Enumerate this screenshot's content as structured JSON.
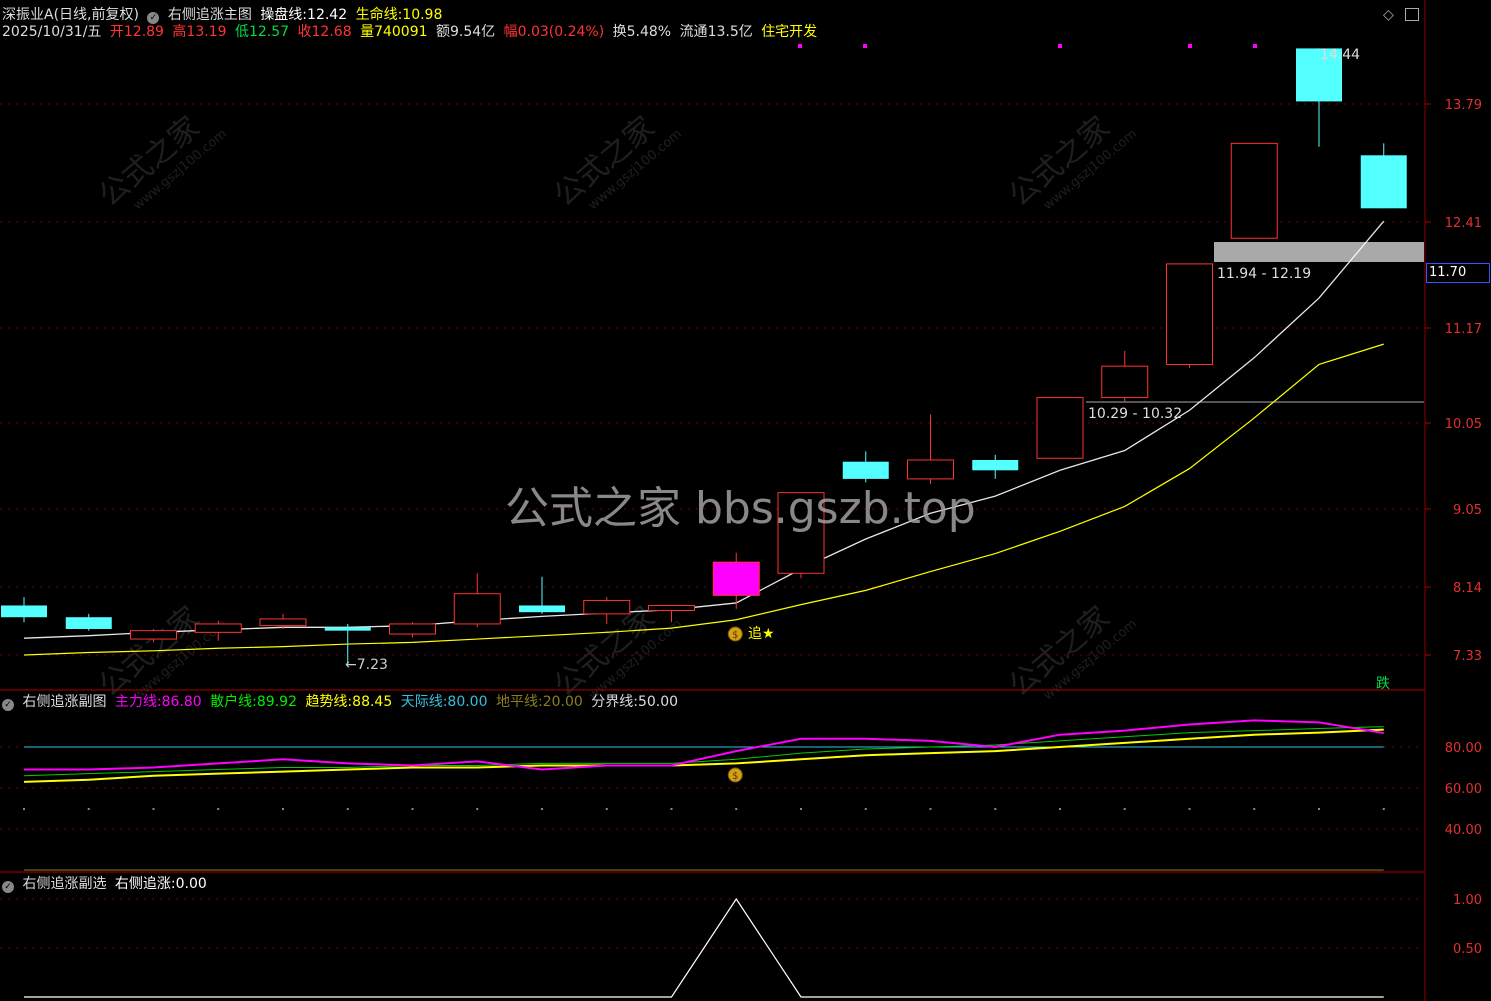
{
  "header": {
    "stock_name": "深振业A",
    "period": "(日线,前复权)",
    "indicator_name": "右侧追涨主图",
    "caopan_label": "操盘线:",
    "caopan_value": "12.42",
    "life_label": "生命线:",
    "life_value": "10.98",
    "date": "2025/10/31/五",
    "open_label": "开",
    "open": "12.89",
    "high_label": "高",
    "high": "13.19",
    "low_label": "低",
    "low": "12.57",
    "close_label": "收",
    "close": "12.68",
    "vol_label": "量",
    "vol": "740091",
    "amount_label": "额",
    "amount": "9.54亿",
    "change_label": "幅",
    "change": "0.03(0.24%)",
    "turnover_label": "换",
    "turnover": "5.48%",
    "float_label": "流通",
    "float": "13.5亿",
    "sector": "住宅开发"
  },
  "sub1": {
    "title": "右侧追涨副图",
    "zhuli_label": "主力线:",
    "zhuli_value": "86.80",
    "sanhu_label": "散户线:",
    "sanhu_value": "89.92",
    "qushi_label": "趋势线:",
    "qushi_value": "88.45",
    "tianji_label": "天际线:",
    "tianji_value": "80.00",
    "dipin_label": "地平线:",
    "dipin_value": "20.00",
    "fenjie_label": "分界线:",
    "fenjie_value": "50.00"
  },
  "sub2": {
    "title": "右侧追涨副选",
    "label": "右侧追涨:",
    "value": "0.00"
  },
  "annotations": {
    "low_marker": "←7.23",
    "zone_upper": "11.94 - 12.19",
    "zone_lower": "10.29 - 10.32",
    "chase_label": "追",
    "high_marker": "14.44",
    "current_price": "11.70",
    "die_label": "跌",
    "watermark_center": "公式之家 bbs.gszb.top",
    "watermark_cn": "公式之家",
    "watermark_url": "www.gszj100.com"
  },
  "colors": {
    "up": "#ff3333",
    "down": "#54ffff",
    "signal": "#ff00ff",
    "caopan": "#ffffff",
    "life": "#ffff00",
    "grid": "#8b0000"
  },
  "chart_data": [
    {
      "type": "candlestick",
      "title": "右侧追涨主图",
      "yticks": [
        7.33,
        8.14,
        9.05,
        10.05,
        11.17,
        12.41,
        13.79
      ],
      "ylim": [
        7.0,
        14.8
      ],
      "candles": [
        {
          "o": 7.92,
          "h": 8.02,
          "l": 7.72,
          "c": 7.78
        },
        {
          "o": 7.78,
          "h": 7.82,
          "l": 7.62,
          "c": 7.64
        },
        {
          "o": 7.52,
          "h": 7.64,
          "l": 7.48,
          "c": 7.62
        },
        {
          "o": 7.6,
          "h": 7.74,
          "l": 7.5,
          "c": 7.7
        },
        {
          "o": 7.68,
          "h": 7.82,
          "l": 7.64,
          "c": 7.76
        },
        {
          "o": 7.66,
          "h": 7.7,
          "l": 7.23,
          "c": 7.62
        },
        {
          "o": 7.58,
          "h": 7.72,
          "l": 7.54,
          "c": 7.7
        },
        {
          "o": 7.7,
          "h": 8.3,
          "l": 7.66,
          "c": 8.06
        },
        {
          "o": 7.92,
          "h": 8.26,
          "l": 7.82,
          "c": 7.84
        },
        {
          "o": 7.82,
          "h": 8.02,
          "l": 7.7,
          "c": 7.98
        },
        {
          "o": 7.86,
          "h": 7.92,
          "l": 7.72,
          "c": 7.92
        },
        {
          "o": 8.04,
          "h": 8.54,
          "l": 7.88,
          "c": 8.43,
          "signal": true
        },
        {
          "o": 8.3,
          "h": 9.24,
          "l": 8.24,
          "c": 9.24
        },
        {
          "o": 9.6,
          "h": 9.72,
          "l": 9.36,
          "c": 9.4
        },
        {
          "o": 9.4,
          "h": 10.15,
          "l": 9.34,
          "c": 9.62
        },
        {
          "o": 9.62,
          "h": 9.68,
          "l": 9.4,
          "c": 9.5
        },
        {
          "o": 9.64,
          "h": 10.35,
          "l": 9.64,
          "c": 10.35
        },
        {
          "o": 10.35,
          "h": 10.9,
          "l": 10.3,
          "c": 10.72
        },
        {
          "o": 10.74,
          "h": 11.92,
          "l": 10.7,
          "c": 11.92
        },
        {
          "o": 12.22,
          "h": 13.33,
          "l": 12.22,
          "c": 13.33
        },
        {
          "o": 14.44,
          "h": 14.44,
          "l": 13.29,
          "c": 13.82
        },
        {
          "o": 13.19,
          "h": 13.33,
          "l": 12.57,
          "c": 12.57
        }
      ],
      "series": [
        {
          "name": "操盘线",
          "values": [
            7.53,
            7.56,
            7.6,
            7.63,
            7.66,
            7.66,
            7.68,
            7.74,
            7.79,
            7.83,
            7.87,
            7.95,
            8.35,
            8.7,
            9.0,
            9.2,
            9.5,
            9.73,
            10.2,
            10.82,
            11.52,
            12.42
          ]
        },
        {
          "name": "生命线",
          "values": [
            7.33,
            7.36,
            7.38,
            7.41,
            7.43,
            7.46,
            7.48,
            7.52,
            7.56,
            7.6,
            7.65,
            7.75,
            7.93,
            8.1,
            8.32,
            8.53,
            8.79,
            9.08,
            9.52,
            10.11,
            10.74,
            10.98
          ]
        }
      ]
    },
    {
      "type": "line",
      "title": "右侧追涨副图",
      "yticks": [
        40,
        60,
        80
      ],
      "ylim": [
        20,
        100
      ],
      "series": [
        {
          "name": "主力线",
          "values": [
            69,
            69,
            70,
            72,
            74,
            72,
            71,
            73,
            69,
            71,
            71,
            78,
            84,
            84,
            83,
            80,
            86,
            88,
            91,
            93,
            92,
            86.8
          ]
        },
        {
          "name": "散户线",
          "values": [
            66,
            67,
            68,
            69,
            70,
            70,
            71,
            71,
            72,
            72,
            72,
            74,
            77,
            79,
            80,
            81,
            83,
            85,
            87,
            88,
            89,
            89.92
          ]
        },
        {
          "name": "趋势线",
          "values": [
            63,
            64,
            66,
            67,
            68,
            69,
            70,
            70,
            71,
            71,
            71,
            72,
            74,
            76,
            77,
            78,
            80,
            82,
            84,
            86,
            87,
            88.45
          ]
        },
        {
          "name": "天际线",
          "values": [
            80,
            80,
            80,
            80,
            80,
            80,
            80,
            80,
            80,
            80,
            80,
            80,
            80,
            80,
            80,
            80,
            80,
            80,
            80,
            80,
            80,
            80
          ]
        },
        {
          "name": "地平线",
          "values": [
            20,
            20,
            20,
            20,
            20,
            20,
            20,
            20,
            20,
            20,
            20,
            20,
            20,
            20,
            20,
            20,
            20,
            20,
            20,
            20,
            20,
            20
          ]
        }
      ]
    },
    {
      "type": "line",
      "title": "右侧追涨副选",
      "yticks": [
        0.5,
        1.0
      ],
      "ylim": [
        0,
        1.1
      ],
      "series": [
        {
          "name": "右侧追涨",
          "values": [
            0,
            0,
            0,
            0,
            0,
            0,
            0,
            0,
            0,
            0,
            0,
            1,
            0,
            0,
            0,
            0,
            0,
            0,
            0,
            0,
            0,
            0
          ]
        }
      ]
    }
  ]
}
